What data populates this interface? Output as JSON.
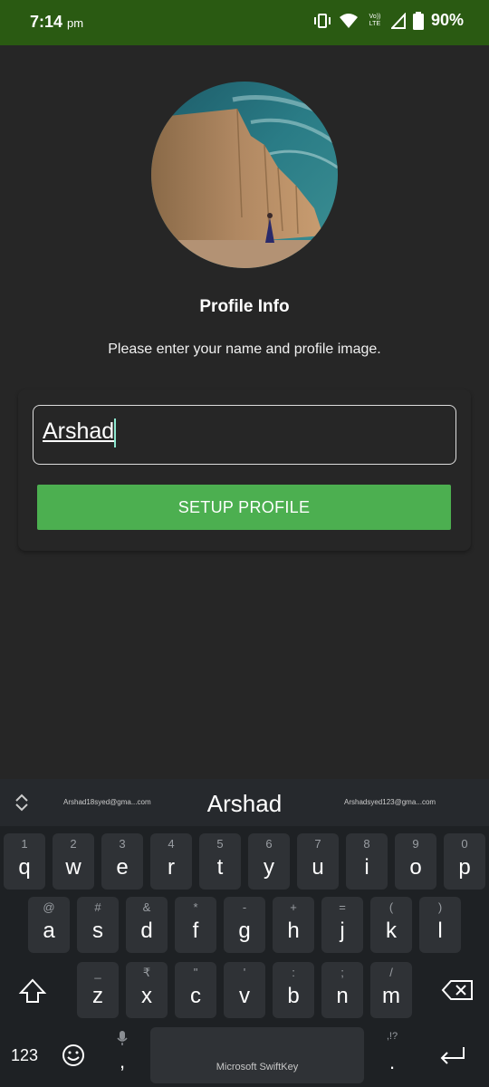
{
  "status": {
    "time": "7:14",
    "ampm": "pm",
    "battery": "90%",
    "volte": "Vo)) LTE"
  },
  "profile": {
    "title": "Profile Info",
    "subtitle": "Please enter your name and profile image.",
    "name_value": "Arshad",
    "button_label": "SETUP PROFILE"
  },
  "keyboard": {
    "suggestions": [
      "Arshad18syed@gma...com",
      "Arshad",
      "Arshadsyed123@gma...com"
    ],
    "row1": [
      {
        "hint": "1",
        "label": "q"
      },
      {
        "hint": "2",
        "label": "w"
      },
      {
        "hint": "3",
        "label": "e"
      },
      {
        "hint": "4",
        "label": "r"
      },
      {
        "hint": "5",
        "label": "t"
      },
      {
        "hint": "6",
        "label": "y"
      },
      {
        "hint": "7",
        "label": "u"
      },
      {
        "hint": "8",
        "label": "i"
      },
      {
        "hint": "9",
        "label": "o"
      },
      {
        "hint": "0",
        "label": "p"
      }
    ],
    "row2": [
      {
        "hint": "@",
        "label": "a"
      },
      {
        "hint": "#",
        "label": "s"
      },
      {
        "hint": "&",
        "label": "d"
      },
      {
        "hint": "*",
        "label": "f"
      },
      {
        "hint": "-",
        "label": "g"
      },
      {
        "hint": "+",
        "label": "h"
      },
      {
        "hint": "=",
        "label": "j"
      },
      {
        "hint": "(",
        "label": "k"
      },
      {
        "hint": ")",
        "label": "l"
      }
    ],
    "row3": [
      {
        "hint": "_",
        "label": "z"
      },
      {
        "hint": "₹",
        "label": "x"
      },
      {
        "hint": "\"",
        "label": "c"
      },
      {
        "hint": "'",
        "label": "v"
      },
      {
        "hint": ":",
        "label": "b"
      },
      {
        "hint": ";",
        "label": "n"
      },
      {
        "hint": "/",
        "label": "m"
      }
    ],
    "numbers_label": "123",
    "comma_label": ",",
    "period_hint": ",!?",
    "period_label": ".",
    "space_label": "Microsoft SwiftKey"
  },
  "colors": {
    "statusbar": "#2a5a12",
    "background": "#262626",
    "button": "#4caf50",
    "keyboard": "#1e2124"
  },
  "icons": [
    "vibrate-icon",
    "wifi-icon",
    "signal-icon",
    "battery-icon",
    "expand-icon",
    "shift-icon",
    "backspace-icon",
    "emoji-icon",
    "mic-icon",
    "enter-icon"
  ]
}
